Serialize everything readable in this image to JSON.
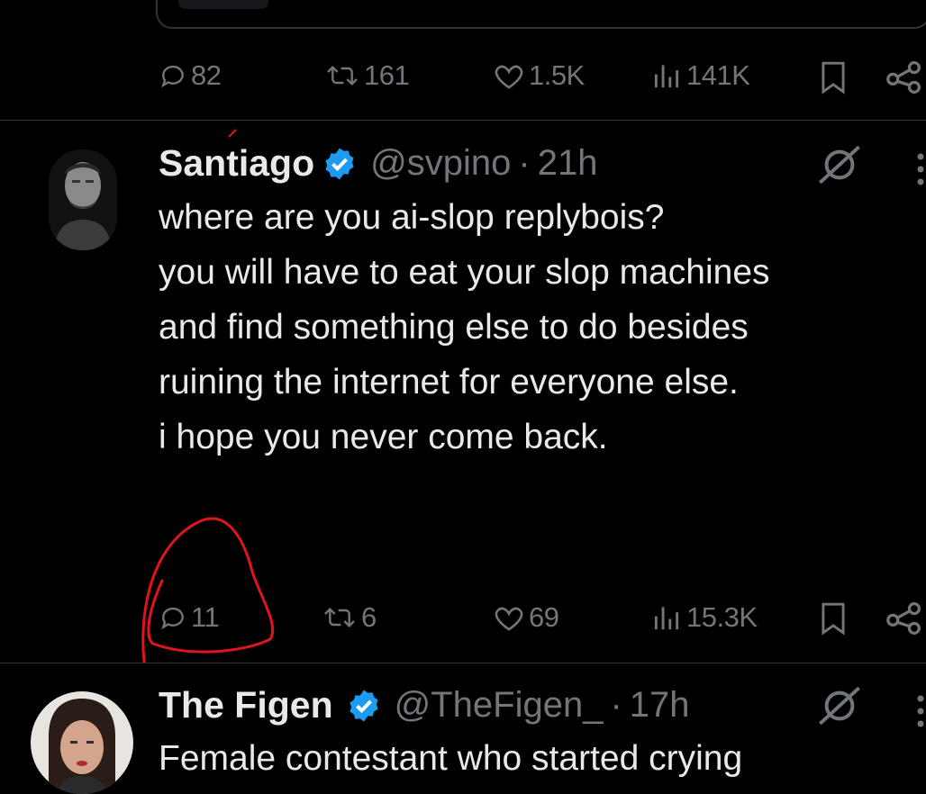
{
  "previous_tweet": {
    "actions": {
      "replies": "82",
      "reposts": "161",
      "likes": "1.5K",
      "views": "141K"
    }
  },
  "tweet": {
    "author_name": "Santiago",
    "author_handle": "@svpino",
    "separator": "·",
    "time": "21h",
    "verified": true,
    "text_lines": [
      "where are you ai-slop replybois?",
      "",
      "you will have to eat your slop machines",
      "and find something else to do besides",
      "ruining the internet for everyone else.",
      "",
      "i hope you never come back."
    ],
    "actions": {
      "replies": "11",
      "reposts": "6",
      "likes": "69",
      "views": "15.3K"
    }
  },
  "next_tweet": {
    "author_name": "The Figen",
    "author_handle": "@TheFigen_",
    "separator": "·",
    "time": "17h",
    "verified": true,
    "text_preview": "Female contestant who started crying"
  },
  "colors": {
    "background": "#000000",
    "text_primary": "#e7e9ea",
    "text_secondary": "#71767b",
    "verified_badge": "#1d9bf0",
    "divider": "#2f3336",
    "annotation_circle": "#e0141b"
  },
  "icons": [
    "reply-icon",
    "repost-icon",
    "like-icon",
    "views-icon",
    "bookmark-icon",
    "share-icon",
    "grok-icon",
    "more-icon",
    "verified-badge-icon"
  ]
}
